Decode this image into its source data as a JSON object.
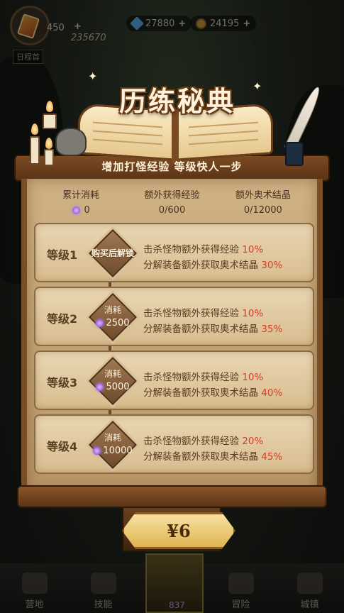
{
  "hud": {
    "tickets": "450",
    "power": "235670",
    "gems": "27880",
    "coins": "24195",
    "plus": "+"
  },
  "modal": {
    "title": "历练秘典",
    "subtitle": "增加打怪经验 等级快人一步",
    "stats": [
      {
        "label": "累计消耗",
        "value": "0",
        "icon": "crystal-icon"
      },
      {
        "label": "额外获得经验",
        "value": "0/600"
      },
      {
        "label": "额外奥术结晶",
        "value": "0/12000"
      }
    ],
    "levels": [
      {
        "name": "等级1",
        "badge": "购买后解锁",
        "exp_prefix": "击杀怪物额外获得经验 ",
        "exp_pct": "10%",
        "crystal_prefix": "分解装备额外获取奥术结晶 ",
        "crystal_pct": "30%"
      },
      {
        "name": "等级2",
        "cost_label": "消耗",
        "cost": "2500",
        "exp_prefix": "击杀怪物额外获得经验 ",
        "exp_pct": "10%",
        "crystal_prefix": "分解装备额外获取奥术结晶 ",
        "crystal_pct": "35%"
      },
      {
        "name": "等级3",
        "cost_label": "消耗",
        "cost": "5000",
        "exp_prefix": "击杀怪物额外获得经验 ",
        "exp_pct": "10%",
        "crystal_prefix": "分解装备额外获取奥术结晶 ",
        "crystal_pct": "40%"
      },
      {
        "name": "等级4",
        "cost_label": "消耗",
        "cost": "10000",
        "exp_prefix": "击杀怪物额外获得经验 ",
        "exp_pct": "20%",
        "crystal_prefix": "分解装备额外获取奥术结晶 ",
        "crystal_pct": "45%"
      }
    ],
    "price": "¥6"
  },
  "background": {
    "battle_label": "日程首",
    "nav": [
      {
        "label": "营地"
      },
      {
        "label": "技能"
      },
      {
        "label": ""
      },
      {
        "label": "冒险"
      },
      {
        "label": "城镇"
      }
    ],
    "center_value": "837"
  },
  "colors": {
    "highlight": "#d23d2a",
    "parchment": "#cfb285",
    "wood": "#7a4e26",
    "button": "#e0b453"
  }
}
